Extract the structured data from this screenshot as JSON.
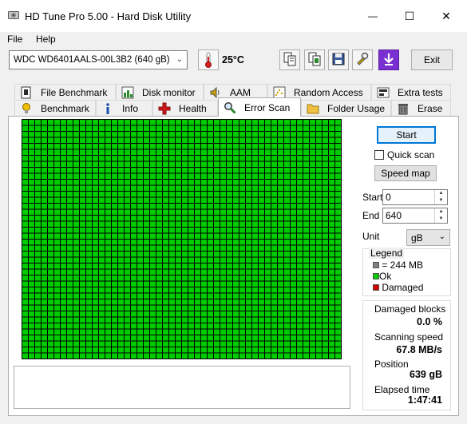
{
  "window": {
    "title": "HD Tune Pro 5.00 - Hard Disk Utility",
    "controls": {
      "minimize": "—",
      "maximize": "☐",
      "close": "✕"
    }
  },
  "menu": {
    "file": "File",
    "help": "Help"
  },
  "toolbar": {
    "drive": "WDC WD6401AALS-00L3B2 (640 gB)",
    "temperature": "25°C",
    "exit_label": "Exit",
    "icons": [
      "copy-text-icon",
      "copy-screenshot-icon",
      "save-icon",
      "options-icon",
      "download-icon"
    ]
  },
  "tabs": {
    "top_row": [
      {
        "label": "File Benchmark",
        "icon": "file-benchmark-icon"
      },
      {
        "label": "Disk monitor",
        "icon": "disk-monitor-icon"
      },
      {
        "label": "AAM",
        "icon": "speaker-icon"
      },
      {
        "label": "Random Access",
        "icon": "random-access-icon"
      },
      {
        "label": "Extra tests",
        "icon": "extra-tests-icon"
      }
    ],
    "bottom_row": [
      {
        "label": "Benchmark",
        "icon": "lightbulb-icon"
      },
      {
        "label": "Info",
        "icon": "info-icon"
      },
      {
        "label": "Health",
        "icon": "health-cross-icon"
      },
      {
        "label": "Error Scan",
        "icon": "magnifier-icon",
        "active": true
      },
      {
        "label": "Folder Usage",
        "icon": "folder-icon"
      },
      {
        "label": "Erase",
        "icon": "trash-icon"
      }
    ]
  },
  "scan": {
    "grid_columns": 50,
    "grid_rows": 40,
    "block_state": "ok",
    "colors": {
      "ok": "#00cc00",
      "damaged": "#cc0000",
      "block": "#808080",
      "grid": "#000000"
    }
  },
  "controls": {
    "start_label": "Start",
    "quick_scan_label": "Quick scan",
    "quick_scan_checked": false,
    "speed_map_label": "Speed map",
    "start_field_label": "Start",
    "start_value": "0",
    "end_field_label": "End",
    "end_value": "640",
    "unit_label": "Unit",
    "unit_value": "gB"
  },
  "legend": {
    "title": "Legend",
    "items": [
      {
        "label": "= 244 MB",
        "color": "#808080"
      },
      {
        "label": "Ok",
        "color": "#00cc00"
      },
      {
        "label": "Damaged",
        "color": "#cc0000"
      }
    ]
  },
  "stats": {
    "damaged_blocks_label": "Damaged blocks",
    "damaged_blocks_value": "0.0 %",
    "scanning_speed_label": "Scanning speed",
    "scanning_speed_value": "67.8 MB/s",
    "position_label": "Position",
    "position_value": "639 gB",
    "elapsed_label": "Elapsed time",
    "elapsed_value": "1:47:41"
  }
}
